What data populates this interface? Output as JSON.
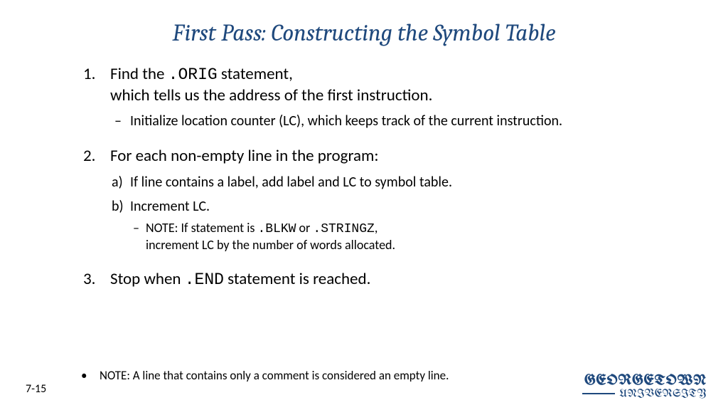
{
  "title": "First Pass: Constructing the Symbol Table",
  "list": {
    "item1": {
      "text_a": "Find the ",
      "code_a": ".ORIG",
      "text_b": " statement,",
      "text_c": "which tells us the address of the first instruction.",
      "sub1": "Initialize location counter (LC), which keeps track of the current instruction."
    },
    "item2": {
      "text": "For each non-empty line in the program:",
      "sub_a": "If line contains a label, add label and LC to symbol table.",
      "sub_b": "Increment LC.",
      "note_a": "NOTE: If statement is ",
      "note_code1": ".BLKW",
      "note_b": " or ",
      "note_code2": ".STRINGZ",
      "note_c": ",",
      "note_d": "increment LC by the number of words allocated."
    },
    "item3": {
      "text_a": "Stop when ",
      "code_a": ".END",
      "text_b": " statement is reached."
    }
  },
  "footer_note": "NOTE: A line that contains only a comment is considered an empty line.",
  "page_num": "7-15",
  "logo": {
    "line1": "GEORGETOWN",
    "line2": "UNIVERSITY"
  }
}
